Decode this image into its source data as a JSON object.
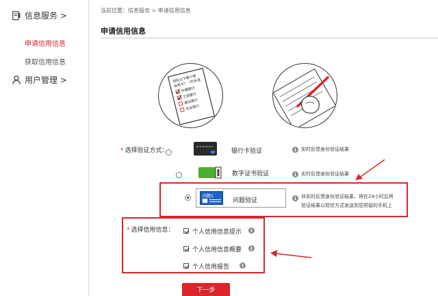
{
  "sidebar": {
    "groups": [
      {
        "label": "信息服务 >",
        "icon": "document-icon"
      },
      {
        "label": "用户管理 >",
        "icon": "user-icon"
      }
    ],
    "items": [
      {
        "label": "申请信用信息",
        "active": true
      },
      {
        "label": "获取信用信息",
        "active": false
      }
    ]
  },
  "breadcrumb": "当前位置：信息服务 > 申请信用信息",
  "page_title": "申请信用信息",
  "illustration": {
    "card_lines": [
      "您在以下哪个银",
      "信用卡？（可多选",
      "中国银行",
      "工商银行",
      "建设银行",
      "农业银行"
    ]
  },
  "verify": {
    "label": "选择验证方式：",
    "options": [
      {
        "label": "银行卡验证",
        "note": "实时反馈身份验证结果",
        "icon": "bank-card-icon",
        "selected": false
      },
      {
        "label": "数字证书验证",
        "note": "实时反馈身份验证结果",
        "icon": "digital-certificate-icon",
        "selected": false
      },
      {
        "label": "问题验证",
        "icon_text": "问题1",
        "note_line1": "非实时反馈身份验证结果，将在24小时后将",
        "note_line2": "验证结果以短信方式发送到您预留的手机上",
        "icon": "question-icon",
        "selected": true
      }
    ]
  },
  "credit": {
    "label": "选择信用信息：",
    "options": [
      {
        "label": "个人信用信息提示",
        "checked": true
      },
      {
        "label": "个人信用信息概要",
        "checked": true
      },
      {
        "label": "个人信用报告",
        "checked": true
      }
    ]
  },
  "next_button": "下一步",
  "colors": {
    "accent": "#d9252b",
    "green": "#4caf2f",
    "blue": "#1f64c4"
  }
}
